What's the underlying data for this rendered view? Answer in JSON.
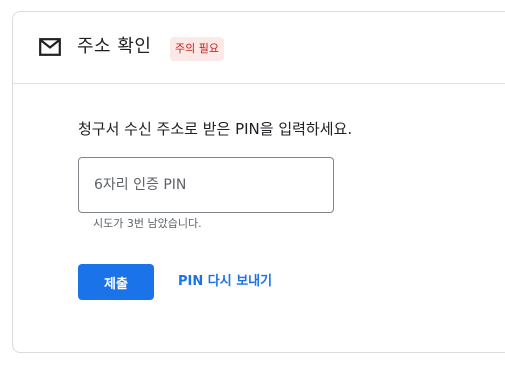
{
  "header": {
    "title": "주소 확인",
    "badge": "주의 필요",
    "icon": "mail-icon"
  },
  "body": {
    "instruction": "청구서 수신 주소로 받은 PIN을 입력하세요.",
    "pin_input": {
      "placeholder": "6자리 인증 PIN",
      "value": ""
    },
    "helper_text": "시도가 3번 남았습니다."
  },
  "actions": {
    "submit_label": "제출",
    "resend_label": "PIN 다시 보내기"
  },
  "colors": {
    "primary": "#1a73e8",
    "badge_bg": "#fce8e6",
    "badge_text": "#c5221f"
  }
}
